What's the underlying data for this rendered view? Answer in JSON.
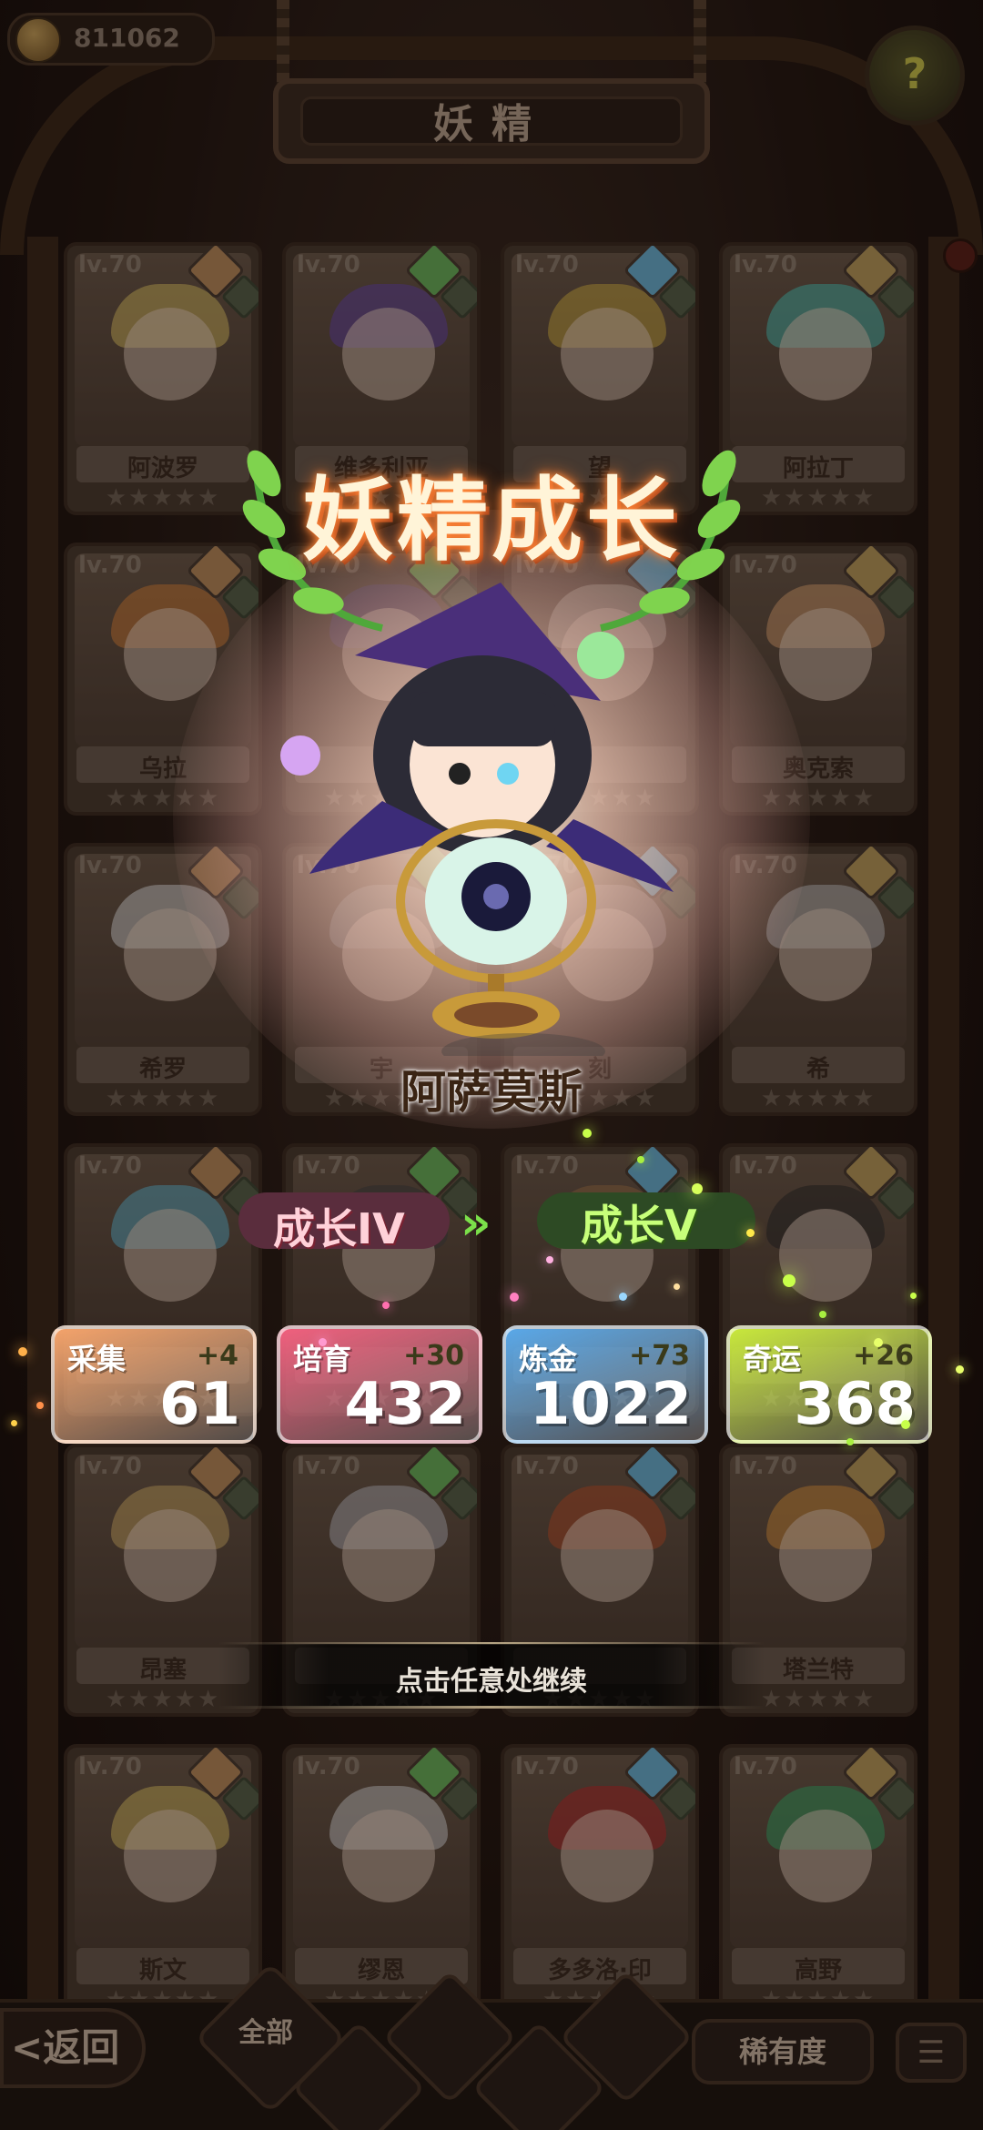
{
  "header": {
    "currency_value": "811062",
    "currency_icon": "crown-coin-icon",
    "title": "妖精",
    "help_icon": "question-sprout-icon"
  },
  "cards": [
    {
      "lv": "lv.70",
      "name": "阿波罗",
      "stars": "★★★★★"
    },
    {
      "lv": "lv.70",
      "name": "维多利亚",
      "stars": "★★★★★"
    },
    {
      "lv": "lv.70",
      "name": "望",
      "stars": "★★★★★"
    },
    {
      "lv": "lv.70",
      "name": "阿拉丁",
      "stars": "★★★★★"
    },
    {
      "lv": "lv.70",
      "name": "乌拉",
      "stars": "★★★★★"
    },
    {
      "lv": "lv.70",
      "name": "",
      "stars": "★★★★★"
    },
    {
      "lv": "lv.70",
      "name": "",
      "stars": "★★★★★"
    },
    {
      "lv": "lv.70",
      "name": "奥克索",
      "stars": "★★★★★"
    },
    {
      "lv": "lv.70",
      "name": "希罗",
      "stars": "★★★★★"
    },
    {
      "lv": "lv.70",
      "name": "宇",
      "stars": "★★★★★"
    },
    {
      "lv": "lv.70",
      "name": "刻",
      "stars": "★★★★★"
    },
    {
      "lv": "lv.70",
      "name": "希",
      "stars": "★★★★★"
    },
    {
      "lv": "lv.70",
      "name": "",
      "stars": "★★★★★"
    },
    {
      "lv": "lv.70",
      "name": "",
      "stars": "★★★★★"
    },
    {
      "lv": "lv.70",
      "name": "",
      "stars": "★★★★★"
    },
    {
      "lv": "lv.70",
      "name": "",
      "stars": "★★★★★"
    },
    {
      "lv": "lv.70",
      "name": "昂塞",
      "stars": "★★★★★"
    },
    {
      "lv": "lv.70",
      "name": "",
      "stars": "★★★★★"
    },
    {
      "lv": "lv.70",
      "name": "",
      "stars": "★★★★★"
    },
    {
      "lv": "lv.70",
      "name": "塔兰特",
      "stars": "★★★★★"
    },
    {
      "lv": "lv.70",
      "name": "斯文",
      "stars": "★★★★★"
    },
    {
      "lv": "lv.70",
      "name": "缪恩",
      "stars": "★★★★★"
    },
    {
      "lv": "lv.70",
      "name": "多多洛·印",
      "stars": "★★★★★"
    },
    {
      "lv": "lv.70",
      "name": "高野",
      "stars": "★★★★★"
    }
  ],
  "popup": {
    "title": "妖精成长",
    "character_name": "阿萨莫斯",
    "growth_from": "成长IV",
    "growth_arrow": "»",
    "growth_to": "成长V",
    "stats": [
      {
        "label": "采集",
        "plus": "+4",
        "value": "61",
        "color": "#f4a36b"
      },
      {
        "label": "培育",
        "plus": "+30",
        "value": "432",
        "color": "#f0607e"
      },
      {
        "label": "炼金",
        "plus": "+73",
        "value": "1022",
        "color": "#5aa8e8"
      },
      {
        "label": "奇运",
        "plus": "+26",
        "value": "368",
        "color": "#c8e83c"
      }
    ],
    "continue_hint": "点击任意处继续"
  },
  "footer": {
    "back_label": "<返回",
    "filter_all": "全部",
    "rarity_label": "稀有度",
    "sort_icon": "sort-list-icon"
  }
}
